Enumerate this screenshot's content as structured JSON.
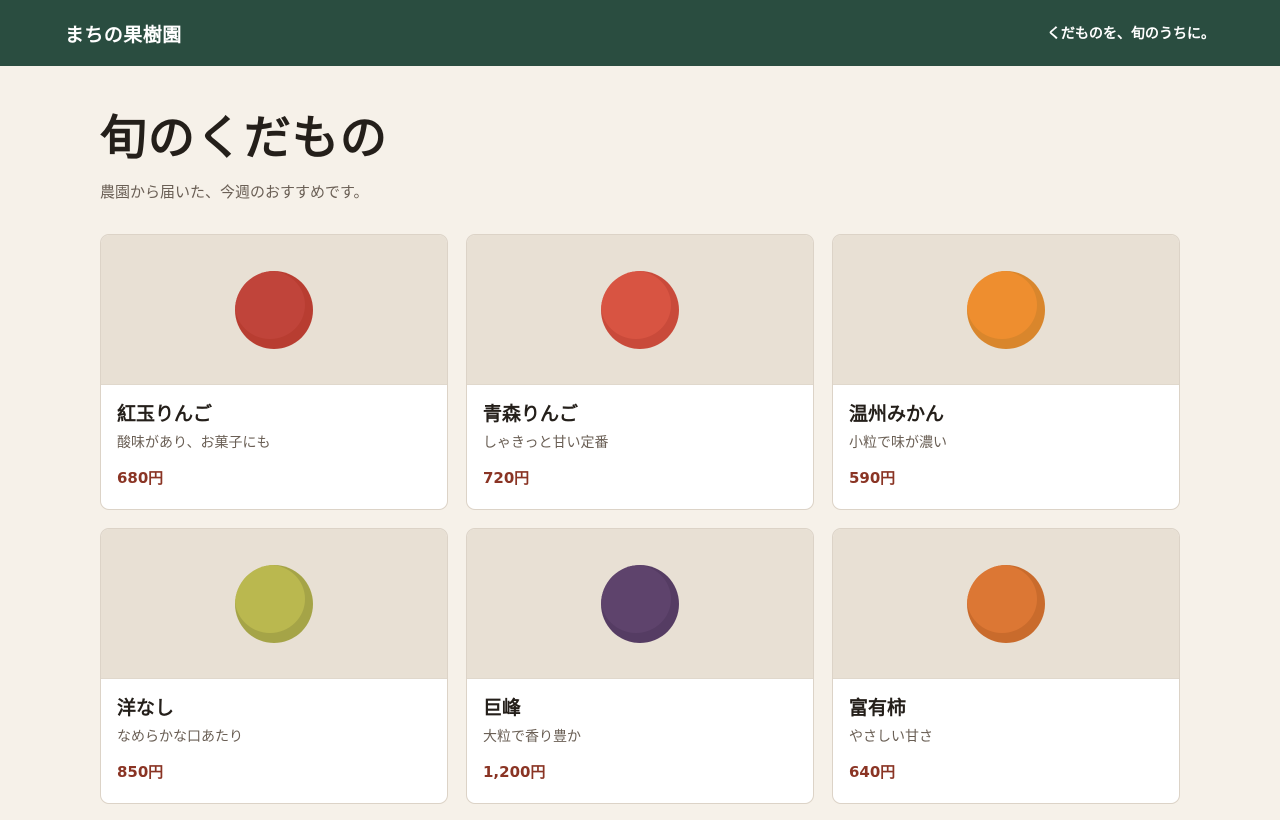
{
  "header": {
    "brand": "まちの果樹園",
    "tagline": "くだものを、旬のうちに。"
  },
  "main": {
    "title": "旬のくだもの",
    "subtitle": "農園から届いた、今週のおすすめです。"
  },
  "products": [
    {
      "name": "紅玉りんご",
      "desc": "酸味があり、お菓子にも",
      "price": "680円",
      "color": "#b83d31",
      "highlight": "#c0443a"
    },
    {
      "name": "青森りんご",
      "desc": "しゃきっと甘い定番",
      "price": "720円",
      "color": "#c94a3a",
      "highlight": "#d85442"
    },
    {
      "name": "温州みかん",
      "desc": "小粒で味が濃い",
      "price": "590円",
      "color": "#d9862c",
      "highlight": "#ee8e2f"
    },
    {
      "name": "洋なし",
      "desc": "なめらかな口あたり",
      "price": "850円",
      "color": "#a5a447",
      "highlight": "#bab84f"
    },
    {
      "name": "巨峰",
      "desc": "大粒で香り豊か",
      "price": "1,200円",
      "color": "#553c63",
      "highlight": "#5e436c"
    },
    {
      "name": "富有柿",
      "desc": "やさしい甘さ",
      "price": "640円",
      "color": "#c96b2c",
      "highlight": "#dc7734"
    }
  ]
}
